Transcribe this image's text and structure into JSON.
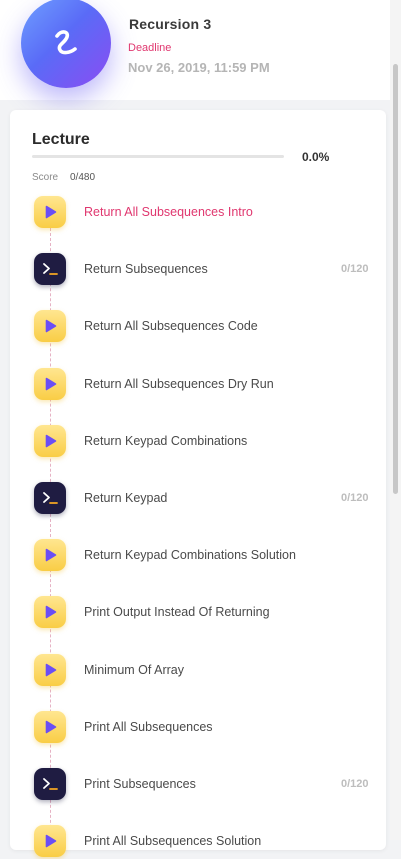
{
  "header": {
    "title": "Recursion 3",
    "deadline_label": "Deadline",
    "deadline_value": "Nov 26, 2019, 11:59 PM"
  },
  "lecture": {
    "title": "Lecture",
    "progress_text": "0.0%",
    "progress_fraction": 0.0,
    "score_label": "Score",
    "score_value": "0/480"
  },
  "colors": {
    "accent_pink": "#e0376f",
    "video_icon_yellow": "#f9cd45",
    "code_icon_navy": "#1f1c42",
    "play_purple": "#6b4ef5"
  },
  "items": [
    {
      "label": "Return All Subsequences Intro",
      "icon": "play-icon",
      "score": "",
      "active": true
    },
    {
      "label": "Return Subsequences",
      "icon": "terminal-icon",
      "score": "0/120",
      "active": false
    },
    {
      "label": "Return All Subsequences Code",
      "icon": "play-icon",
      "score": "",
      "active": false
    },
    {
      "label": "Return All Subsequences Dry Run",
      "icon": "play-icon",
      "score": "",
      "active": false
    },
    {
      "label": "Return Keypad Combinations",
      "icon": "play-icon",
      "score": "",
      "active": false
    },
    {
      "label": "Return Keypad",
      "icon": "terminal-icon",
      "score": "0/120",
      "active": false
    },
    {
      "label": "Return Keypad Combinations Solution",
      "icon": "play-icon",
      "score": "",
      "active": false
    },
    {
      "label": "Print Output Instead Of Returning",
      "icon": "play-icon",
      "score": "",
      "active": false
    },
    {
      "label": "Minimum Of Array",
      "icon": "play-icon",
      "score": "",
      "active": false
    },
    {
      "label": "Print All Subsequences",
      "icon": "play-icon",
      "score": "",
      "active": false
    },
    {
      "label": "Print Subsequences",
      "icon": "terminal-icon",
      "score": "0/120",
      "active": false
    },
    {
      "label": "Print All Subsequences Solution",
      "icon": "play-icon",
      "score": "",
      "active": false
    }
  ]
}
